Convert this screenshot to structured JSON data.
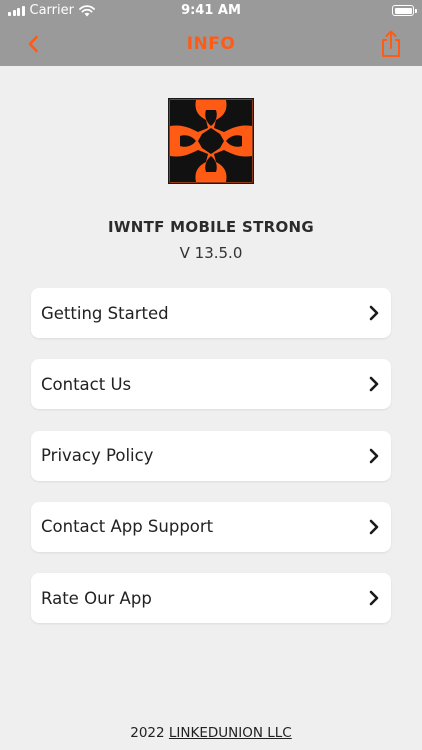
{
  "status_bar": {
    "carrier": "Carrier",
    "time": "9:41 AM"
  },
  "nav": {
    "title": "INFO",
    "back_icon": "chevron-left-icon",
    "share_icon": "share-icon",
    "accent_color": "#ff5b14"
  },
  "app": {
    "name": "IWNTF MOBILE STRONG",
    "version": "V 13.5.0"
  },
  "menu": {
    "items": [
      {
        "label": "Getting Started"
      },
      {
        "label": "Contact Us"
      },
      {
        "label": "Privacy Policy"
      },
      {
        "label": "Contact App Support"
      },
      {
        "label": "Rate Our App"
      }
    ]
  },
  "footer": {
    "year": "2022",
    "company": "LINKEDUNION LLC"
  }
}
